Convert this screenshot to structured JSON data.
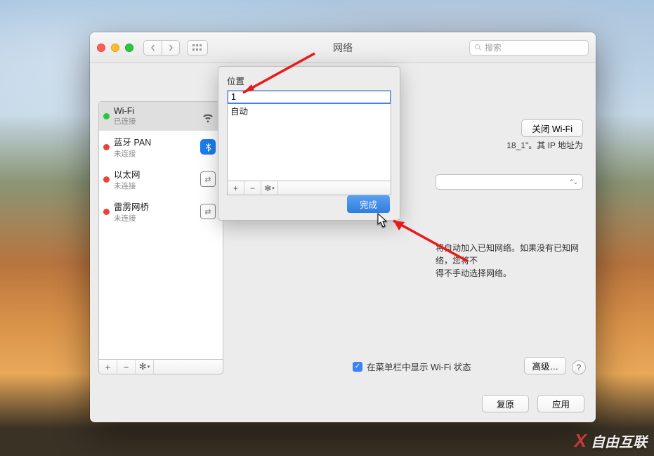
{
  "window": {
    "title": "网络",
    "search_placeholder": "搜索"
  },
  "location_bar": {
    "label_prefix": "位"
  },
  "sidebar": {
    "items": [
      {
        "name": "Wi-Fi",
        "status": "已连接",
        "dot": "green",
        "selected": true,
        "icon": "wifi"
      },
      {
        "name": "蓝牙 PAN",
        "status": "未连接",
        "dot": "red",
        "selected": false,
        "icon": "bluetooth"
      },
      {
        "name": "以太网",
        "status": "未连接",
        "dot": "red",
        "selected": false,
        "icon": "ethernet"
      },
      {
        "name": "雷雳网桥",
        "status": "未连接",
        "dot": "red",
        "selected": false,
        "icon": "thunderbolt"
      }
    ]
  },
  "detail": {
    "turn_off_wifi": "关闭 Wi-Fi",
    "ip_suffix": "18_1\"。其 IP 地址为",
    "auto_join_line1": "将自动加入已知网络。如果没有已知网络，您将不",
    "auto_join_line2": "得不手动选择网络。",
    "menubar_label": "在菜单栏中显示 Wi-Fi 状态",
    "advanced_label": "高级…"
  },
  "popover": {
    "label": "位置",
    "rows": [
      {
        "text": "1",
        "editing": true
      },
      {
        "text": "自动",
        "editing": false
      }
    ],
    "done_label": "完成"
  },
  "footer": {
    "revert": "复原",
    "apply": "应用"
  },
  "watermark": "自由互联"
}
